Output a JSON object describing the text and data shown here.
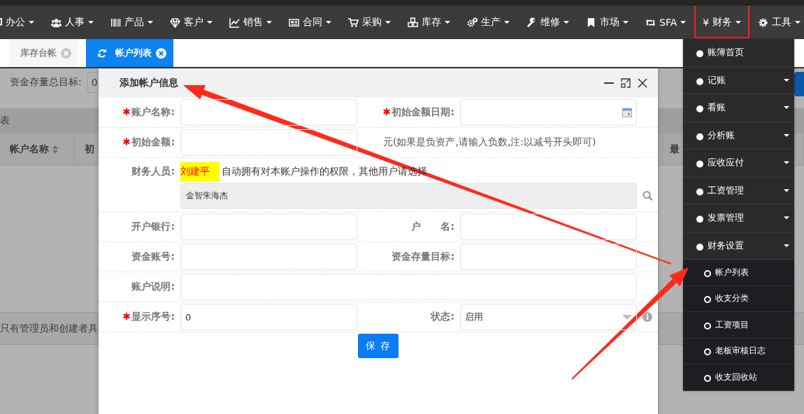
{
  "nav": {
    "items": [
      {
        "label": "办公",
        "highlighted": false
      },
      {
        "label": "人事",
        "highlighted": false
      },
      {
        "label": "产品",
        "highlighted": false
      },
      {
        "label": "客户",
        "highlighted": false
      },
      {
        "label": "销售",
        "highlighted": false
      },
      {
        "label": "合同",
        "highlighted": false
      },
      {
        "label": "采购",
        "highlighted": false
      },
      {
        "label": "库存",
        "highlighted": false
      },
      {
        "label": "生产",
        "highlighted": false
      },
      {
        "label": "维修",
        "highlighted": false
      },
      {
        "label": "市场",
        "highlighted": false
      },
      {
        "label": "SFA",
        "highlighted": false
      },
      {
        "label": "财务",
        "glyph": "¥",
        "highlighted": true
      },
      {
        "label": "工具",
        "highlighted": false
      }
    ]
  },
  "tabs": [
    {
      "label": "库存台帐",
      "selected": false
    },
    {
      "label": "帐户列表",
      "selected": true
    }
  ],
  "background_page": {
    "target_label": "资金存量总目标:",
    "target_value": "0",
    "panel_title": "表",
    "columns": [
      {
        "label": "帐户名称",
        "sortable": true
      },
      {
        "label": "初",
        "sortable": false
      },
      {
        "label": "最",
        "sortable": false
      }
    ],
    "footer_note": "只有管理员和创建者具"
  },
  "dialog": {
    "title": "添加帐户信息",
    "rows": [
      {
        "kind": "pair",
        "fields": [
          {
            "label": "账户名称:",
            "required": true,
            "kind": "text"
          },
          {
            "label": "初始金额日期:",
            "required": true,
            "kind": "date"
          }
        ]
      },
      {
        "kind": "note",
        "fields": [
          {
            "label": "初始金额:",
            "required": true,
            "kind": "text"
          }
        ],
        "note": "元(如果是负资产,请输入负数,注:以减号开头即可)"
      },
      {
        "kind": "staff",
        "label": "财务人员:",
        "highlight": "刘建平",
        "note": "自动拥有对本账户操作的权限，其他用户请选择",
        "value": "金智朱海杰"
      },
      {
        "kind": "pair",
        "fields": [
          {
            "label": "开户银行:",
            "required": false,
            "kind": "text"
          },
          {
            "label": "户　　名:",
            "required": false,
            "kind": "text"
          }
        ]
      },
      {
        "kind": "pair",
        "fields": [
          {
            "label": "资金账号:",
            "required": false,
            "kind": "text"
          },
          {
            "label": "资金存量目标:",
            "required": false,
            "kind": "text"
          }
        ]
      },
      {
        "kind": "wide",
        "fields": [
          {
            "label": "账户说明:",
            "required": false,
            "kind": "text"
          }
        ]
      },
      {
        "kind": "pair",
        "fields": [
          {
            "label": "显示序号:",
            "required": true,
            "kind": "text",
            "value": "0"
          },
          {
            "label": "状态:",
            "required": false,
            "kind": "select",
            "value": "启用"
          }
        ]
      }
    ],
    "submit": "保 存"
  },
  "menu": {
    "items": [
      {
        "label": "账簿首页",
        "kind": "link"
      },
      {
        "label": "记账",
        "kind": "group"
      },
      {
        "label": "看账",
        "kind": "group"
      },
      {
        "label": "分析账",
        "kind": "group"
      },
      {
        "label": "应收应付",
        "kind": "group"
      },
      {
        "label": "工资管理",
        "kind": "group"
      },
      {
        "label": "发票管理",
        "kind": "group"
      },
      {
        "label": "财务设置",
        "kind": "group",
        "expanded": true,
        "children": [
          {
            "label": "帐户列表"
          },
          {
            "label": "收支分类"
          },
          {
            "label": "工资项目"
          },
          {
            "label": "老板审核日志"
          },
          {
            "label": "收支回收站"
          }
        ]
      }
    ]
  }
}
